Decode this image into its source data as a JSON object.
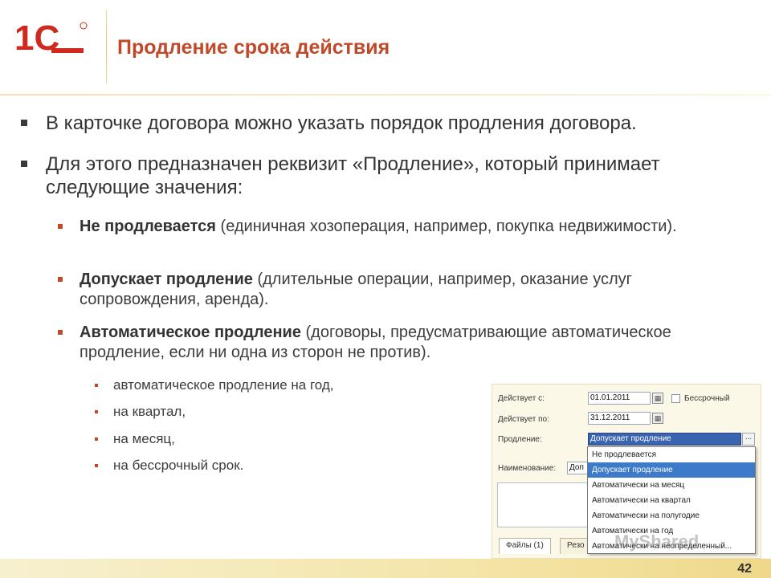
{
  "slide": {
    "logo_text": "1С",
    "title": "Продление срока действия",
    "page_number": "42"
  },
  "bullets": [
    "В карточке договора можно указать порядок продления договора.",
    "Для этого предназначен реквизит «Продление», который принимает следующие значения:"
  ],
  "values": [
    {
      "term": "Не продлевается",
      "desc": " (единичная хозоперация, например, покупка недвижимости)."
    },
    {
      "term": "Допускает продление",
      "desc": " (длительные операции, например, оказание услуг сопровождения, аренда)."
    },
    {
      "term": "Автоматическое продление",
      "desc": " (договоры, предусматривающие автоматическое продление, если ни одна из сторон не против)."
    }
  ],
  "sub_values": [
    "автоматическое продление на год,",
    "на квартал,",
    "на месяц,",
    "на бессрочный срок."
  ],
  "form": {
    "valid_from_label": "Действует с:",
    "valid_from_value": "01.01.2011",
    "indefinite_label": "Бессрочный",
    "valid_to_label": "Действует по:",
    "valid_to_value": "31.12.2011",
    "extension_label": "Продление:",
    "extension_value": "Допускает продление",
    "name_label": "Наименование:",
    "name_value": "Доп",
    "tabs": [
      "Файлы (1)",
      "Резо"
    ],
    "options": [
      "Не продлевается",
      "Допускает продление",
      "Автоматически на месяц",
      "Автоматически на квартал",
      "Автоматически на полугодие",
      "Автоматически на год",
      "Автоматически на неопределенный..."
    ],
    "selected_option_index": 1
  },
  "watermark": "MyShared",
  "colors": {
    "title": "#c0492a",
    "logo": "#d02a1e",
    "selection": "#3d7ac9"
  },
  "icons": [
    "calendar-icon",
    "checkbox",
    "dots-button"
  ]
}
